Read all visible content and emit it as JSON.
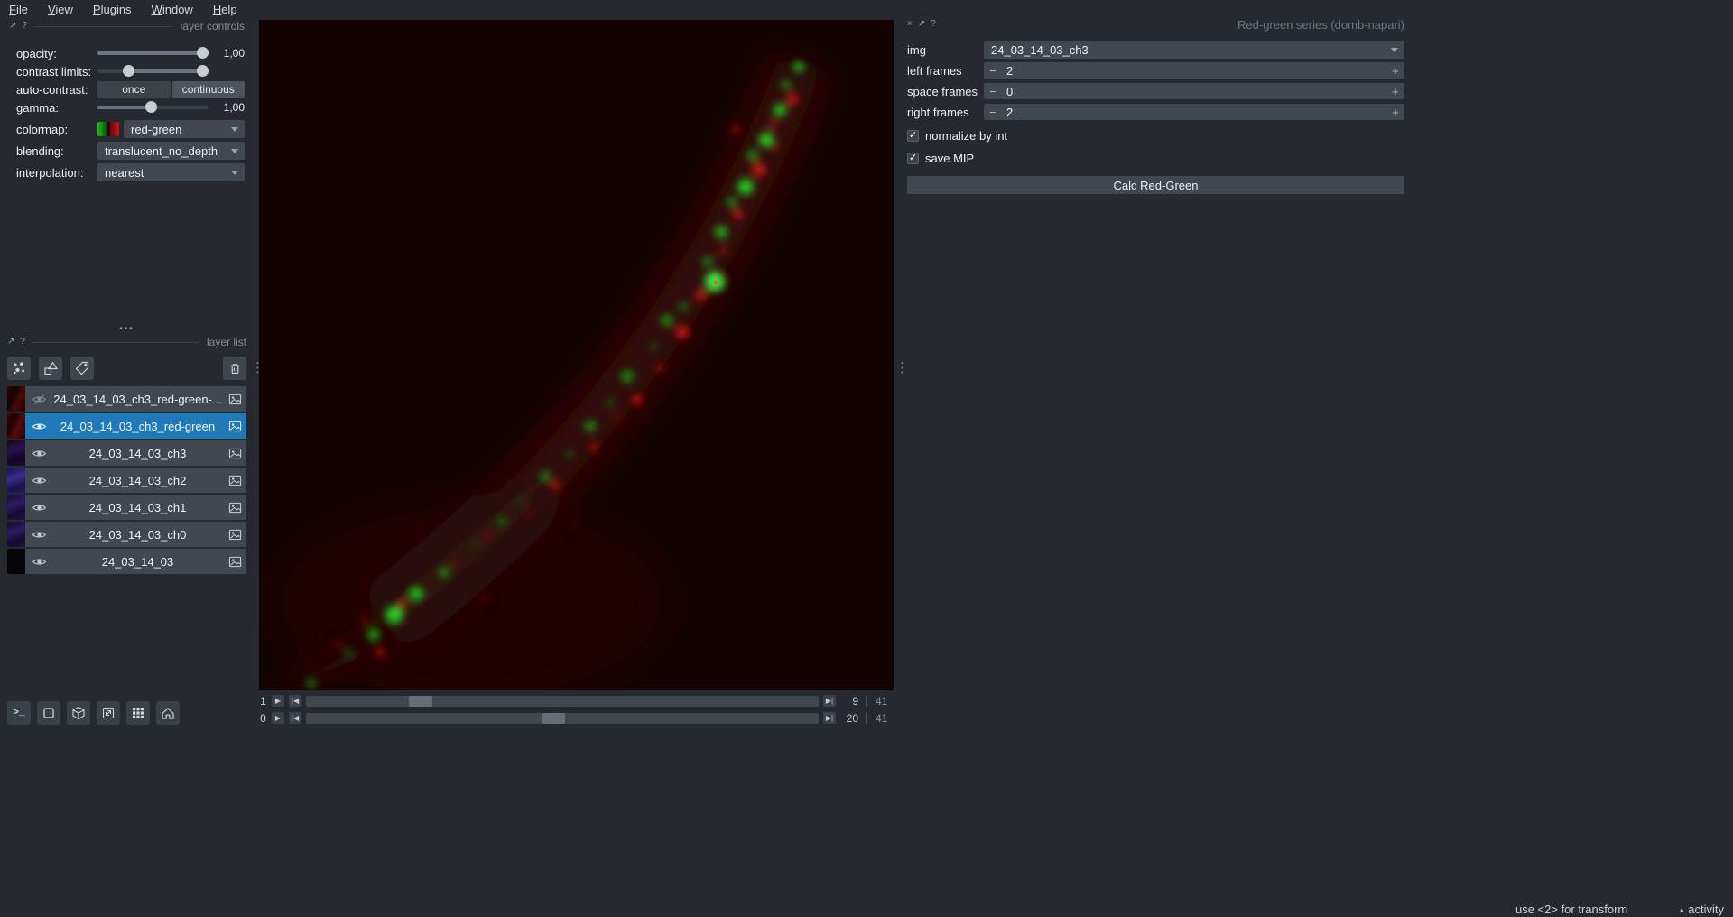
{
  "menu": {
    "items": [
      "File",
      "View",
      "Plugins",
      "Window",
      "Help"
    ]
  },
  "icons": {
    "close": "×",
    "float": "↗",
    "help": "?",
    "minus": "−",
    "plus": "+",
    "check": "✓",
    "play": "▶",
    "skip_start": "|◀",
    "skip_end": "▶|",
    "dots_h": "•••",
    "dots_v": "⋮",
    "activity_caret": "▴",
    "console": ">_"
  },
  "layer_controls": {
    "title": "layer controls",
    "rows": {
      "opacity": {
        "label": "opacity:",
        "value": "1,00"
      },
      "contrast": {
        "label": "contrast limits:"
      },
      "autocontrast": {
        "label": "auto-contrast:",
        "once": "once",
        "continuous": "continuous"
      },
      "gamma": {
        "label": "gamma:",
        "value": "1,00"
      },
      "colormap": {
        "label": "colormap:",
        "value": "red-green"
      },
      "blending": {
        "label": "blending:",
        "value": "translucent_no_depth"
      },
      "interpolation": {
        "label": "interpolation:",
        "value": "nearest"
      }
    }
  },
  "layer_list": {
    "title": "layer list",
    "layers": [
      {
        "name": "24_03_14_03_ch3_red-green-...",
        "visible": false,
        "selected": false
      },
      {
        "name": "24_03_14_03_ch3_red-green",
        "visible": true,
        "selected": true
      },
      {
        "name": "24_03_14_03_ch3",
        "visible": true,
        "selected": false
      },
      {
        "name": "24_03_14_03_ch2",
        "visible": true,
        "selected": false
      },
      {
        "name": "24_03_14_03_ch1",
        "visible": true,
        "selected": false
      },
      {
        "name": "24_03_14_03_ch0",
        "visible": true,
        "selected": false
      },
      {
        "name": "24_03_14_03",
        "visible": true,
        "selected": false
      }
    ]
  },
  "dims": {
    "rows": [
      {
        "axis": "1",
        "current": "9",
        "total": "41"
      },
      {
        "axis": "0",
        "current": "20",
        "total": "41"
      }
    ]
  },
  "plugin": {
    "title": "Red-green series (domb-napari)",
    "img": {
      "label": "img",
      "value": "24_03_14_03_ch3"
    },
    "left_frames": {
      "label": "left frames",
      "value": "2"
    },
    "space_frames": {
      "label": "space frames",
      "value": "0"
    },
    "right_frames": {
      "label": "right frames",
      "value": "2"
    },
    "normalize": {
      "label": "normalize by int",
      "checked": true
    },
    "save_mip": {
      "label": "save MIP",
      "checked": true
    },
    "calc_button": "Calc Red-Green"
  },
  "status": {
    "hint": "use <2> for transform",
    "activity": "activity"
  },
  "colors": {
    "background": "#262930",
    "widget": "#414851",
    "selection": "#2079b8",
    "text": "#f0f1f2",
    "canvas_bg": "#140303",
    "green": "#22cc22",
    "red": "#dd1818"
  }
}
